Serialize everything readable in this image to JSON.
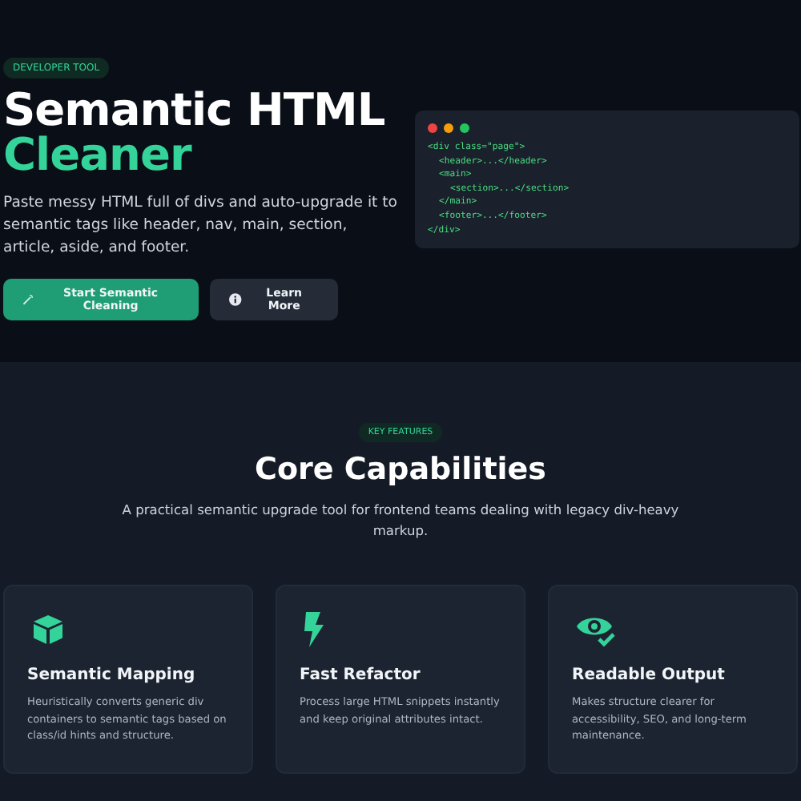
{
  "hero": {
    "badge": "DEVELOPER TOOL",
    "title_line_1": "Semantic HTML",
    "title_line_2": "Cleaner",
    "description": "Paste messy HTML full of divs and auto-upgrade it to semantic tags like header, nav, main, section, article, aside, and footer.",
    "buttons": [
      {
        "label": "Start Semantic Cleaning",
        "kind": "primary"
      },
      {
        "label": "Learn More",
        "kind": "secondary"
      }
    ],
    "code": [
      {
        "text": "<div class=\"page\">",
        "children": [
          {
            "text": "<header>...</header>"
          },
          {
            "text": "<main>",
            "children": [
              {
                "text": "<section>...</section>"
              }
            ]
          },
          {
            "text": "</main>"
          },
          {
            "text": "<footer>...</footer>"
          }
        ]
      },
      {
        "text": "</div>"
      }
    ]
  },
  "features": {
    "badge": "KEY FEATURES",
    "title": "Core Capabilities",
    "subtitle": "A practical semantic upgrade tool for frontend teams dealing with legacy div-heavy markup.",
    "cards": [
      {
        "kind": "cube",
        "title": "Semantic Mapping",
        "text": "Heuristically converts generic div containers to semantic tags based on class/id hints and structure."
      },
      {
        "kind": "bolt",
        "title": "Fast Refactor",
        "text": "Process large HTML snippets instantly and keep original attributes intact."
      },
      {
        "kind": "eye",
        "title": "Readable Output",
        "text": "Makes structure clearer for accessibility, SEO, and long-term maintenance."
      }
    ]
  }
}
